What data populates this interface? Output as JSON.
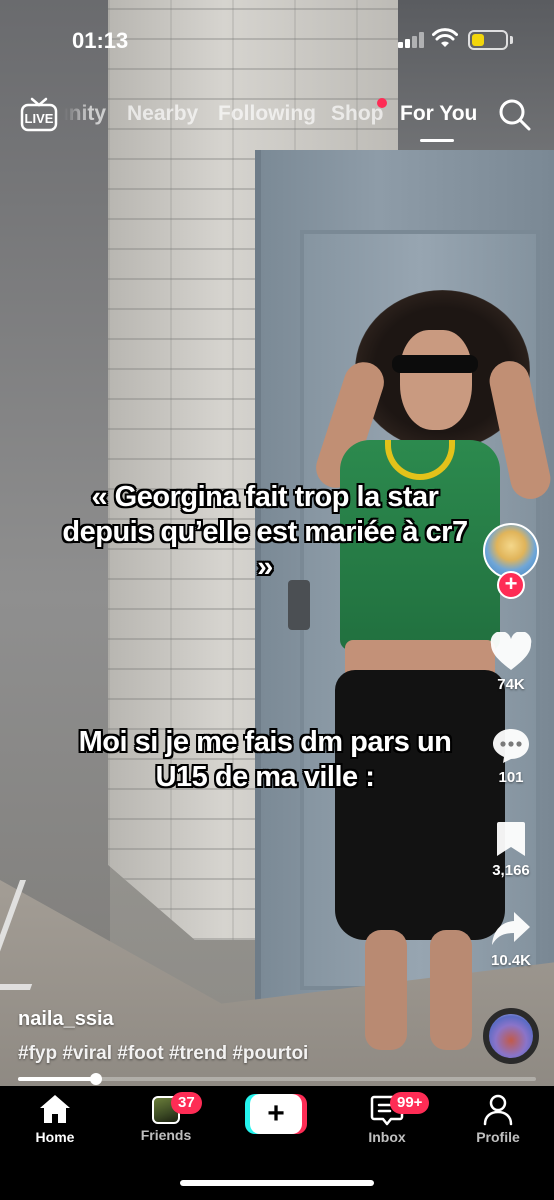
{
  "status_bar": {
    "time": "01:13"
  },
  "top_nav": {
    "live_label": "LIVE",
    "tabs": [
      {
        "label": "Community"
      },
      {
        "label": "Nearby"
      },
      {
        "label": "Following"
      },
      {
        "label": "Shop"
      },
      {
        "label": "For You"
      }
    ],
    "active_tab": "For You"
  },
  "video": {
    "captions": [
      "« Georgina fait trop la star depuis qu’elle est mariée à cr7 »",
      "Moi si je me fais dm pars un U15 de ma ville :"
    ],
    "username": "naila_ssia",
    "hashtags": "#fyp #viral #foot #trend #pourtoi",
    "progress": 0.15
  },
  "actions": {
    "likes": "74K",
    "comments": "101",
    "saves": "3,166",
    "shares": "10.4K"
  },
  "tab_bar": {
    "home": "Home",
    "friends": "Friends",
    "friends_badge": "37",
    "create": "+",
    "inbox": "Inbox",
    "inbox_badge": "99+",
    "profile": "Profile"
  },
  "colors": {
    "accent": "#fe2c55",
    "accent_cyan": "#25f4ee",
    "battery": "#f2d60b"
  }
}
